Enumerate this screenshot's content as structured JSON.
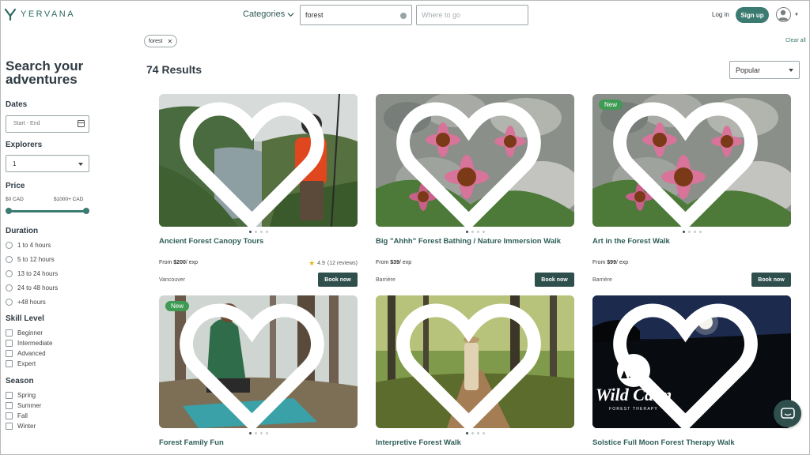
{
  "header": {
    "logo_text": "YERVANA",
    "categories_label": "Categories",
    "search_value": "forest",
    "where_placeholder": "Where to go",
    "login_label": "Log in",
    "signup_label": "Sign up"
  },
  "filters_bar": {
    "chip_label": "forest",
    "clear_all_label": "Clear all"
  },
  "sidebar": {
    "title": "Search your adventures",
    "dates": {
      "heading": "Dates",
      "placeholder": "Start - End"
    },
    "explorers": {
      "heading": "Explorers",
      "value": "1"
    },
    "price": {
      "heading": "Price",
      "min_label": "$0 CAD",
      "max_label": "$1000+ CAD",
      "min_fraction": 0,
      "max_fraction": 1
    },
    "duration": {
      "heading": "Duration",
      "options": [
        "1 to 4 hours",
        "5 to 12 hours",
        "13 to 24 hours",
        "24 to 48 hours",
        "+48 hours"
      ]
    },
    "skill": {
      "heading": "Skill Level",
      "options": [
        "Beginner",
        "Intermediate",
        "Advanced",
        "Expert"
      ]
    },
    "season": {
      "heading": "Season",
      "options": [
        "Spring",
        "Summer",
        "Fall",
        "Winter"
      ]
    }
  },
  "results": {
    "count_label": "74 Results",
    "sort_value": "Popular",
    "cards": [
      {
        "title": "Ancient Forest Canopy Tours",
        "price": "$200",
        "price_unit": "/ exp",
        "price_prefix": "From ",
        "rating": "4.9",
        "reviews": "(12 reviews)",
        "location": "Vancouver",
        "book_label": "Book now",
        "badge": ""
      },
      {
        "title": "Big \"Ahhh\" Forest Bathing / Nature Immersion Walk",
        "price": "$39",
        "price_unit": "/ exp",
        "price_prefix": "From ",
        "rating": "",
        "reviews": "",
        "location": "Barrière",
        "book_label": "Book now",
        "badge": ""
      },
      {
        "title": "Art in the Forest Walk",
        "price": "$99",
        "price_unit": "/ exp",
        "price_prefix": "From ",
        "rating": "",
        "reviews": "",
        "location": "Barrière",
        "book_label": "Book now",
        "badge": "New"
      },
      {
        "title": "Forest Family Fun",
        "badge": "New"
      },
      {
        "title": "Interpretive Forest Walk",
        "badge": ""
      },
      {
        "title": "Solstice Full Moon Forest Therapy Walk",
        "badge": "",
        "image_logo_text": "Wild Calm",
        "image_logo_sub": "FOREST THERAPY"
      }
    ]
  },
  "colors": {
    "brand": "#3c7b71",
    "button_dark": "#2f4f4c",
    "badge_new": "#3f9b54",
    "title_text": "#2e5e58"
  }
}
